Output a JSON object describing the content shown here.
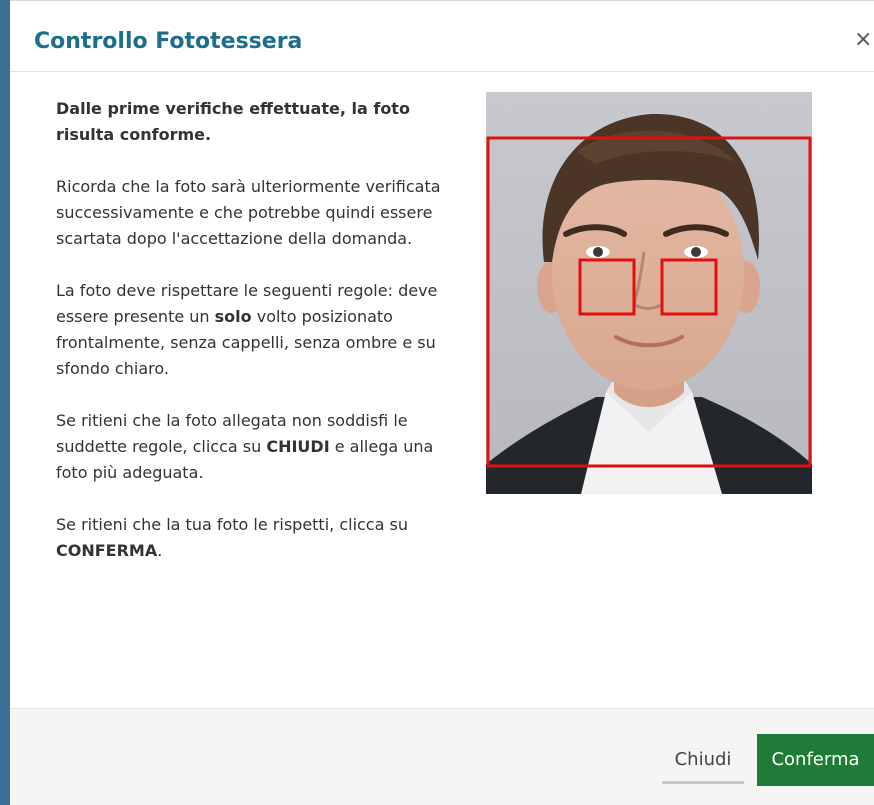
{
  "dialog": {
    "title": "Controllo Fototessera",
    "close_glyph": "×",
    "paragraphs": {
      "lead": "Dalle prime verifiche effettuate, la foto risulta conforme.",
      "p2": "Ricorda che la foto sarà ulteriormente verificata successivamente e che potrebbe quindi essere scartata dopo l'accettazione della domanda.",
      "p3_before": "La foto deve rispettare le seguenti regole: deve essere presente un ",
      "p3_bold": "solo",
      "p3_after": " volto posizionato frontalmente, senza cappelli, senza ombre e su sfondo chiaro.",
      "p4_before": "Se ritieni che la foto allegata non soddisfi le suddette regole, clicca su ",
      "p4_bold": "CHIUDI",
      "p4_after": " e allega una foto più adeguata.",
      "p5_before": "Se ritieni che la tua foto le rispetti, clicca su ",
      "p5_bold": "CONFERMA",
      "p5_after": "."
    }
  },
  "photo": {
    "description": "passport-photo-with-face-detection-boxes",
    "box_color": "#e01010"
  },
  "footer": {
    "close_label": "Chiudi",
    "confirm_label": "Conferma"
  },
  "colors": {
    "accent": "#3b6f95",
    "title": "#1c6e8c",
    "confirm_bg": "#1e7b38"
  }
}
